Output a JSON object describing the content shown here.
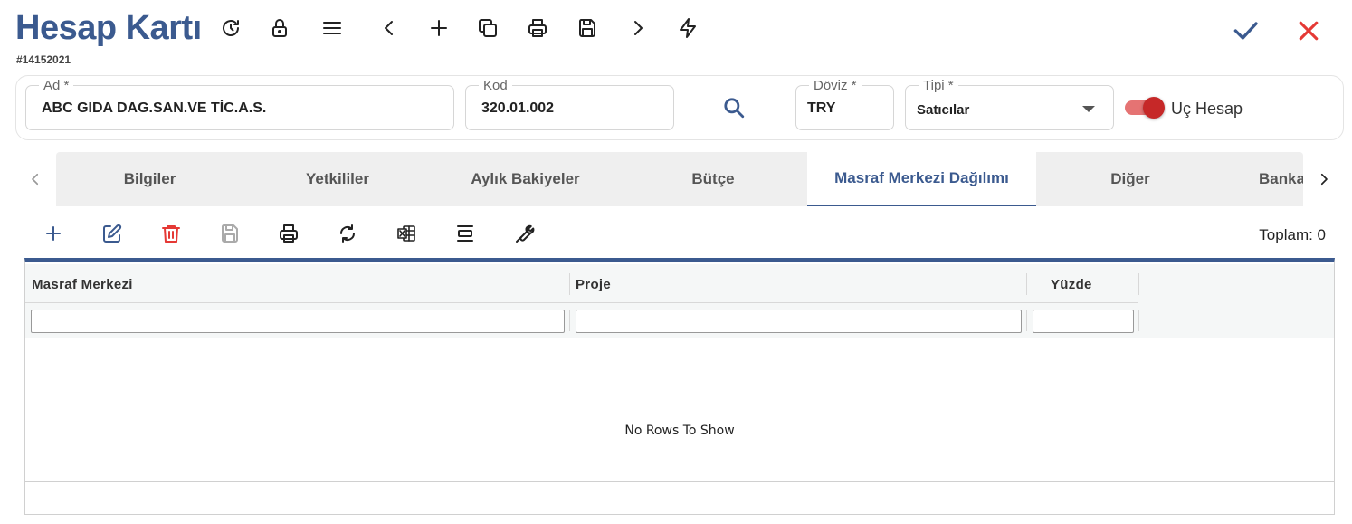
{
  "header": {
    "title": "Hesap Kartı",
    "record_id": "#14152021",
    "buttons": [
      "history-icon",
      "lock-icon",
      "menu-icon",
      "chevron-left-icon",
      "plus-icon",
      "copy-icon",
      "print-icon",
      "save-icon",
      "chevron-right-icon",
      "lightning-icon"
    ],
    "accept_icon": "check-icon",
    "cancel_icon": "close-icon"
  },
  "form": {
    "ad": {
      "label": "Ad *",
      "value": "ABC GIDA DAG.SAN.VE TİC.A.S."
    },
    "kod": {
      "label": "Kod",
      "value": "320.01.002"
    },
    "doviz": {
      "label": "Döviz *",
      "value": "TRY"
    },
    "tipi": {
      "label": "Tipi *",
      "value": "Satıcılar"
    },
    "uc_hesap": {
      "label": "Uç Hesap",
      "checked": true
    }
  },
  "tabs": [
    {
      "label": "Bilgiler",
      "active": false
    },
    {
      "label": "Yetkililer",
      "active": false
    },
    {
      "label": "Aylık Bakiyeler",
      "active": false
    },
    {
      "label": "Bütçe",
      "active": false
    },
    {
      "label": "Masraf Merkezi Dağılımı",
      "active": true
    },
    {
      "label": "Diğer",
      "active": false
    },
    {
      "label": "Banka",
      "active": false
    }
  ],
  "grid": {
    "toolbar": [
      "plus-icon",
      "edit-icon",
      "trash-icon",
      "save-icon",
      "print-icon",
      "refresh-icon",
      "excel-icon",
      "row-height-icon",
      "wrench-icon"
    ],
    "total_label": "Toplam: 0",
    "columns": [
      "Masraf Merkezi",
      "Proje",
      "Yüzde"
    ],
    "empty_text": "No Rows To Show"
  },
  "colors": {
    "accent": "#3b5a8f",
    "danger": "#e53935",
    "toggle_on": "#c62828"
  }
}
